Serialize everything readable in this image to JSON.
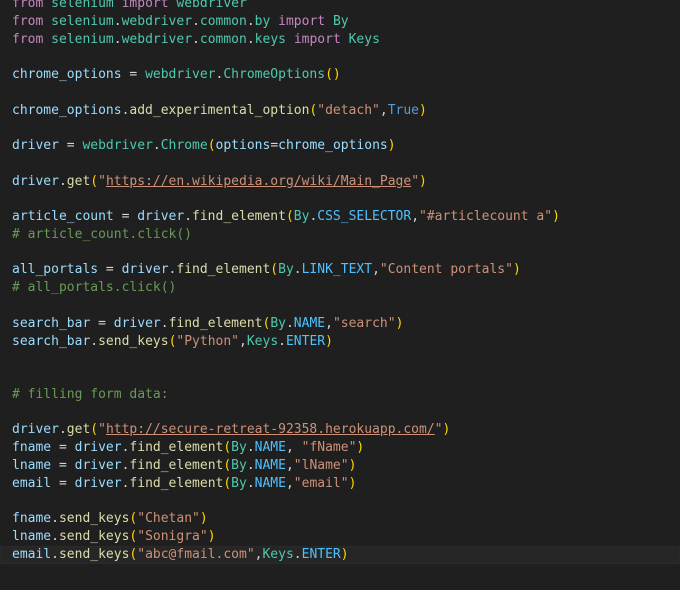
{
  "colors": {
    "background": "#1f1f1f",
    "keyword": "#c586c0",
    "module": "#4ec9b0",
    "variable": "#9cdcfe",
    "function": "#dcdcaa",
    "string": "#ce9178",
    "constant": "#569cd6",
    "comment": "#6a9955",
    "operator": "#d4d4d4",
    "bracket1": "#ffd700",
    "bracket2": "#da70d6"
  },
  "editor": {
    "lines": [
      {
        "tokens": [
          [
            "from",
            "#c586c0"
          ],
          [
            " ",
            "#d4d4d4"
          ],
          [
            "selenium",
            "#4ec9b0"
          ],
          [
            " ",
            "#d4d4d4"
          ],
          [
            "import",
            "#c586c0"
          ],
          [
            " ",
            "#d4d4d4"
          ],
          [
            "webdriver",
            "#4ec9b0"
          ]
        ]
      },
      {
        "tokens": [
          [
            "from",
            "#c586c0"
          ],
          [
            " ",
            "#d4d4d4"
          ],
          [
            "selenium",
            "#4ec9b0"
          ],
          [
            ".",
            "#d4d4d4"
          ],
          [
            "webdriver",
            "#4ec9b0"
          ],
          [
            ".",
            "#d4d4d4"
          ],
          [
            "common",
            "#4ec9b0"
          ],
          [
            ".",
            "#d4d4d4"
          ],
          [
            "by",
            "#4ec9b0"
          ],
          [
            " ",
            "#d4d4d4"
          ],
          [
            "import",
            "#c586c0"
          ],
          [
            " ",
            "#d4d4d4"
          ],
          [
            "By",
            "#4ec9b0"
          ]
        ]
      },
      {
        "tokens": [
          [
            "from",
            "#c586c0"
          ],
          [
            " ",
            "#d4d4d4"
          ],
          [
            "selenium",
            "#4ec9b0"
          ],
          [
            ".",
            "#d4d4d4"
          ],
          [
            "webdriver",
            "#4ec9b0"
          ],
          [
            ".",
            "#d4d4d4"
          ],
          [
            "common",
            "#4ec9b0"
          ],
          [
            ".",
            "#d4d4d4"
          ],
          [
            "keys",
            "#4ec9b0"
          ],
          [
            " ",
            "#d4d4d4"
          ],
          [
            "import",
            "#c586c0"
          ],
          [
            " ",
            "#d4d4d4"
          ],
          [
            "Keys",
            "#4ec9b0"
          ]
        ]
      },
      {
        "tokens": []
      },
      {
        "tokens": [
          [
            "chrome_options",
            "#9cdcfe"
          ],
          [
            " = ",
            "#d4d4d4"
          ],
          [
            "webdriver",
            "#4ec9b0"
          ],
          [
            ".",
            "#d4d4d4"
          ],
          [
            "ChromeOptions",
            "#4ec9b0"
          ],
          [
            "()",
            "#ffd700"
          ]
        ]
      },
      {
        "tokens": []
      },
      {
        "tokens": [
          [
            "chrome_options",
            "#9cdcfe"
          ],
          [
            ".",
            "#d4d4d4"
          ],
          [
            "add_experimental_option",
            "#dcdcaa"
          ],
          [
            "(",
            "#ffd700"
          ],
          [
            "\"detach\"",
            "#ce9178"
          ],
          [
            ",",
            "#d4d4d4"
          ],
          [
            "True",
            "#569cd6"
          ],
          [
            ")",
            "#ffd700"
          ]
        ]
      },
      {
        "tokens": []
      },
      {
        "tokens": [
          [
            "driver",
            "#9cdcfe"
          ],
          [
            " = ",
            "#d4d4d4"
          ],
          [
            "webdriver",
            "#4ec9b0"
          ],
          [
            ".",
            "#d4d4d4"
          ],
          [
            "Chrome",
            "#4ec9b0"
          ],
          [
            "(",
            "#ffd700"
          ],
          [
            "options",
            "#9cdcfe"
          ],
          [
            "=",
            "#d4d4d4"
          ],
          [
            "chrome_options",
            "#9cdcfe"
          ],
          [
            ")",
            "#ffd700"
          ]
        ]
      },
      {
        "tokens": []
      },
      {
        "tokens": [
          [
            "driver",
            "#9cdcfe"
          ],
          [
            ".",
            "#d4d4d4"
          ],
          [
            "get",
            "#dcdcaa"
          ],
          [
            "(",
            "#ffd700"
          ],
          [
            "\"",
            "#ce9178"
          ],
          [
            "https://en.wikipedia.org/wiki/Main_Page",
            "#ce9178",
            "underline"
          ],
          [
            "\"",
            "#ce9178"
          ],
          [
            ")",
            "#ffd700"
          ]
        ]
      },
      {
        "tokens": []
      },
      {
        "tokens": [
          [
            "article_count",
            "#9cdcfe"
          ],
          [
            " = ",
            "#d4d4d4"
          ],
          [
            "driver",
            "#9cdcfe"
          ],
          [
            ".",
            "#d4d4d4"
          ],
          [
            "find_element",
            "#dcdcaa"
          ],
          [
            "(",
            "#ffd700"
          ],
          [
            "By",
            "#4ec9b0"
          ],
          [
            ".",
            "#d4d4d4"
          ],
          [
            "CSS_SELECTOR",
            "#4fc1ff"
          ],
          [
            ",",
            "#d4d4d4"
          ],
          [
            "\"#articlecount a\"",
            "#ce9178"
          ],
          [
            ")",
            "#ffd700"
          ]
        ]
      },
      {
        "tokens": [
          [
            "# article_count.click()",
            "#6a9955"
          ]
        ]
      },
      {
        "tokens": []
      },
      {
        "tokens": [
          [
            "all_portals",
            "#9cdcfe"
          ],
          [
            " = ",
            "#d4d4d4"
          ],
          [
            "driver",
            "#9cdcfe"
          ],
          [
            ".",
            "#d4d4d4"
          ],
          [
            "find_element",
            "#dcdcaa"
          ],
          [
            "(",
            "#ffd700"
          ],
          [
            "By",
            "#4ec9b0"
          ],
          [
            ".",
            "#d4d4d4"
          ],
          [
            "LINK_TEXT",
            "#4fc1ff"
          ],
          [
            ",",
            "#d4d4d4"
          ],
          [
            "\"Content portals\"",
            "#ce9178"
          ],
          [
            ")",
            "#ffd700"
          ]
        ]
      },
      {
        "tokens": [
          [
            "# all_portals.click()",
            "#6a9955"
          ]
        ]
      },
      {
        "tokens": []
      },
      {
        "tokens": [
          [
            "search_bar",
            "#9cdcfe"
          ],
          [
            " = ",
            "#d4d4d4"
          ],
          [
            "driver",
            "#9cdcfe"
          ],
          [
            ".",
            "#d4d4d4"
          ],
          [
            "find_element",
            "#dcdcaa"
          ],
          [
            "(",
            "#ffd700"
          ],
          [
            "By",
            "#4ec9b0"
          ],
          [
            ".",
            "#d4d4d4"
          ],
          [
            "NAME",
            "#4fc1ff"
          ],
          [
            ",",
            "#d4d4d4"
          ],
          [
            "\"search\"",
            "#ce9178"
          ],
          [
            ")",
            "#ffd700"
          ]
        ]
      },
      {
        "tokens": [
          [
            "search_bar",
            "#9cdcfe"
          ],
          [
            ".",
            "#d4d4d4"
          ],
          [
            "send_keys",
            "#dcdcaa"
          ],
          [
            "(",
            "#ffd700"
          ],
          [
            "\"Python\"",
            "#ce9178"
          ],
          [
            ",",
            "#d4d4d4"
          ],
          [
            "Keys",
            "#4ec9b0"
          ],
          [
            ".",
            "#d4d4d4"
          ],
          [
            "ENTER",
            "#4fc1ff"
          ],
          [
            ")",
            "#ffd700"
          ]
        ]
      },
      {
        "tokens": []
      },
      {
        "tokens": []
      },
      {
        "tokens": [
          [
            "# filling form data:",
            "#6a9955"
          ]
        ]
      },
      {
        "tokens": []
      },
      {
        "tokens": [
          [
            "driver",
            "#9cdcfe"
          ],
          [
            ".",
            "#d4d4d4"
          ],
          [
            "get",
            "#dcdcaa"
          ],
          [
            "(",
            "#ffd700"
          ],
          [
            "\"",
            "#ce9178"
          ],
          [
            "http://secure-retreat-92358.herokuapp.com/",
            "#ce9178",
            "underline"
          ],
          [
            "\"",
            "#ce9178"
          ],
          [
            ")",
            "#ffd700"
          ]
        ]
      },
      {
        "tokens": [
          [
            "fname",
            "#9cdcfe"
          ],
          [
            " = ",
            "#d4d4d4"
          ],
          [
            "driver",
            "#9cdcfe"
          ],
          [
            ".",
            "#d4d4d4"
          ],
          [
            "find_element",
            "#dcdcaa"
          ],
          [
            "(",
            "#ffd700"
          ],
          [
            "By",
            "#4ec9b0"
          ],
          [
            ".",
            "#d4d4d4"
          ],
          [
            "NAME",
            "#4fc1ff"
          ],
          [
            ", ",
            "#d4d4d4"
          ],
          [
            "\"fName\"",
            "#ce9178"
          ],
          [
            ")",
            "#ffd700"
          ]
        ]
      },
      {
        "tokens": [
          [
            "lname",
            "#9cdcfe"
          ],
          [
            " = ",
            "#d4d4d4"
          ],
          [
            "driver",
            "#9cdcfe"
          ],
          [
            ".",
            "#d4d4d4"
          ],
          [
            "find_element",
            "#dcdcaa"
          ],
          [
            "(",
            "#ffd700"
          ],
          [
            "By",
            "#4ec9b0"
          ],
          [
            ".",
            "#d4d4d4"
          ],
          [
            "NAME",
            "#4fc1ff"
          ],
          [
            ",",
            "#d4d4d4"
          ],
          [
            "\"lName\"",
            "#ce9178"
          ],
          [
            ")",
            "#ffd700"
          ]
        ]
      },
      {
        "tokens": [
          [
            "email",
            "#9cdcfe"
          ],
          [
            " = ",
            "#d4d4d4"
          ],
          [
            "driver",
            "#9cdcfe"
          ],
          [
            ".",
            "#d4d4d4"
          ],
          [
            "find_element",
            "#dcdcaa"
          ],
          [
            "(",
            "#ffd700"
          ],
          [
            "By",
            "#4ec9b0"
          ],
          [
            ".",
            "#d4d4d4"
          ],
          [
            "NAME",
            "#4fc1ff"
          ],
          [
            ",",
            "#d4d4d4"
          ],
          [
            "\"email\"",
            "#ce9178"
          ],
          [
            ")",
            "#ffd700"
          ]
        ]
      },
      {
        "tokens": []
      },
      {
        "tokens": [
          [
            "fname",
            "#9cdcfe"
          ],
          [
            ".",
            "#d4d4d4"
          ],
          [
            "send_keys",
            "#dcdcaa"
          ],
          [
            "(",
            "#ffd700"
          ],
          [
            "\"Chetan\"",
            "#ce9178"
          ],
          [
            ")",
            "#ffd700"
          ]
        ]
      },
      {
        "tokens": [
          [
            "lname",
            "#9cdcfe"
          ],
          [
            ".",
            "#d4d4d4"
          ],
          [
            "send_keys",
            "#dcdcaa"
          ],
          [
            "(",
            "#ffd700"
          ],
          [
            "\"Sonigra\"",
            "#ce9178"
          ],
          [
            ")",
            "#ffd700"
          ]
        ]
      },
      {
        "tokens": [
          [
            "email",
            "#9cdcfe"
          ],
          [
            ".",
            "#d4d4d4"
          ],
          [
            "send_keys",
            "#dcdcaa"
          ],
          [
            "(",
            "#ffd700"
          ],
          [
            "\"abc@fmail.com\"",
            "#ce9178"
          ],
          [
            ",",
            "#d4d4d4"
          ],
          [
            "Keys",
            "#4ec9b0"
          ],
          [
            ".",
            "#d4d4d4"
          ],
          [
            "ENTER",
            "#4fc1ff"
          ],
          [
            ")",
            "#ffd700"
          ]
        ]
      }
    ]
  }
}
